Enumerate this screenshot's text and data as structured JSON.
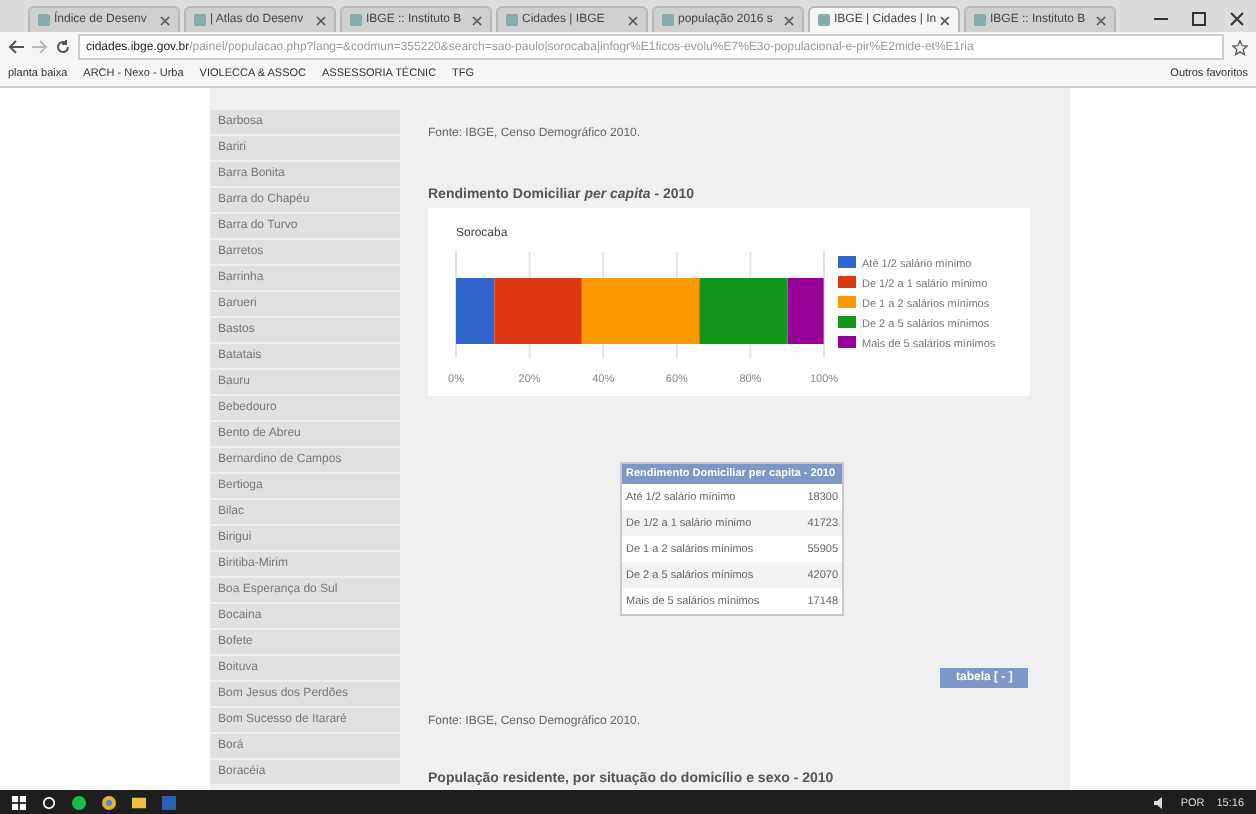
{
  "browser": {
    "tabs": [
      {
        "title": "Índice de Desenv",
        "selected": false
      },
      {
        "title": "| Atlas do Desenv",
        "selected": false
      },
      {
        "title": "IBGE :: Instituto B",
        "selected": false
      },
      {
        "title": "Cidades | IBGE",
        "selected": false
      },
      {
        "title": "população 2016 s",
        "selected": false
      },
      {
        "title": "IBGE | Cidades | In",
        "selected": true
      },
      {
        "title": "IBGE :: Instituto B",
        "selected": false
      }
    ],
    "url_host": "cidades.ibge.gov.br",
    "url_path": "/painel/populacao.php?lang=&codmun=355220&search=sao-paulo|sorocaba|infogr%E1ficos-evolu%E7%E3o-populacional-e-pir%E2mide-et%E1ria",
    "bookmarks": [
      "planta baixa",
      "ARCH - Nexo - Urba",
      "VIOLECCA & ASSOC",
      "ASSESSORIA TÉCNIC",
      "TFG"
    ],
    "other_bookmarks": "Outros favoritos"
  },
  "sidebar": {
    "items": [
      "Barbosa",
      "Bariri",
      "Barra Bonita",
      "Barra do Chapéu",
      "Barra do Turvo",
      "Barretos",
      "Barrinha",
      "Barueri",
      "Bastos",
      "Batatais",
      "Bauru",
      "Bebedouro",
      "Bento de Abreu",
      "Bernardino de Campos",
      "Bertioga",
      "Bilac",
      "Birigui",
      "Biritiba-Mirim",
      "Boa Esperança do Sul",
      "Bocaina",
      "Bofete",
      "Boituva",
      "Bom Jesus dos Perdões",
      "Bom Sucesso de Itararé",
      "Borá",
      "Boracéia"
    ]
  },
  "content": {
    "source_top": "Fonte: IBGE, Censo Demográfico 2010.",
    "section_title": "Rendimento Domiciliar *per capita* - 2010",
    "chart_data": {
      "type": "bar",
      "orientation": "horizontal",
      "stacked": true,
      "grid": true,
      "legend": "right",
      "title": "Sorocaba",
      "series": [
        {
          "name": "Até 1/2 salário mínimo",
          "color": "#3366cc",
          "values": [
            0.104
          ]
        },
        {
          "name": "De 1/2 a 1 salário mínimo",
          "color": "#dc3912",
          "values": [
            0.238
          ]
        },
        {
          "name": "De 1 a 2 salários mínimos",
          "color": "#ff9900",
          "values": [
            0.319
          ]
        },
        {
          "name": "De 2 a 5 salários mínimos",
          "color": "#109618",
          "values": [
            0.24
          ]
        },
        {
          "name": "Mais de 5 salários mínimos",
          "color": "#990099",
          "values": [
            0.098
          ]
        }
      ],
      "xlim": [
        0,
        1
      ],
      "xticks": [
        {
          "value": 0,
          "label": "0%"
        },
        {
          "value": 0.2,
          "label": "20%"
        },
        {
          "value": 0.4,
          "label": "40%"
        },
        {
          "value": 0.6,
          "label": "60%"
        },
        {
          "value": 0.8,
          "label": "80%"
        },
        {
          "value": 1,
          "label": "100%"
        }
      ]
    },
    "table": {
      "header": "Rendimento Domiciliar per capita - 2010",
      "rows": [
        {
          "label": "Até 1/2 salário mínimo",
          "value": "18300"
        },
        {
          "label": "De 1/2 a 1 salário mínimo",
          "value": "41723"
        },
        {
          "label": "De 1 a 2 salários mínimos",
          "value": "55905"
        },
        {
          "label": "De 2 a 5 salários mínimos",
          "value": "42070"
        },
        {
          "label": "Mais de 5 salários mínimos",
          "value": "17148"
        }
      ]
    },
    "table_button": "tabela [ - ]",
    "source_bottom": "Fonte: IBGE, Censo Demográfico 2010.",
    "next_title": "População residente, por situação do domicílio e sexo - 2010"
  },
  "taskbar": {
    "language": "POR",
    "time": "15:16"
  }
}
